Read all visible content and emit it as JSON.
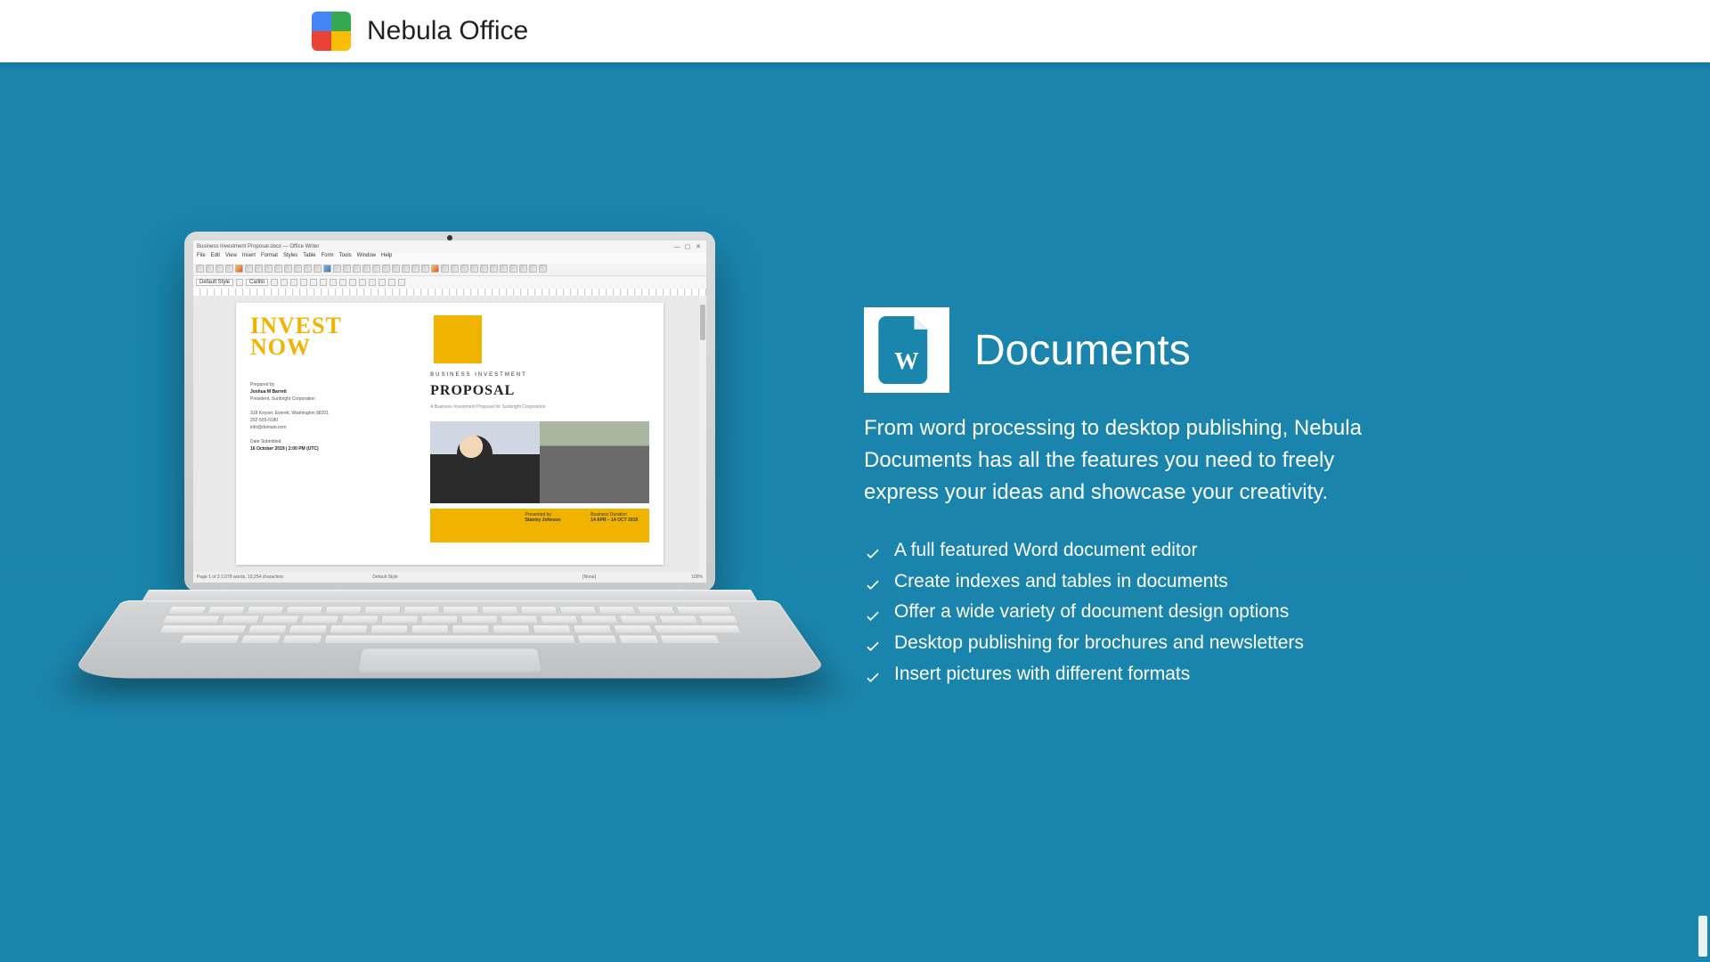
{
  "header": {
    "brand": "Nebula Office"
  },
  "colors": {
    "hero_bg": "#1a85ad",
    "accent_yellow": "#f0b400",
    "doc_icon": "#1a85ad"
  },
  "laptop": {
    "app_title": "Business Investment Proposal.docx — Office Writer",
    "menus": [
      "File",
      "Edit",
      "View",
      "Insert",
      "Format",
      "Styles",
      "Table",
      "Form",
      "Tools",
      "Window",
      "Help"
    ],
    "style_selector": "Default Style",
    "font_selector": "Carlito",
    "doc": {
      "headline_line1": "INVEST",
      "headline_line2": "NOW",
      "subject_label": "BUSINESS INVESTMENT",
      "subject_big": "PROPOSAL",
      "subject_sub": "A Business Investment Proposal\nfor Sunbright Corporation",
      "meta_prepared_label": "Prepared by",
      "meta_prepared_value": "Joshua M Barrett",
      "meta_title": "President, Sunbright Corporation",
      "meta_address": "318 Keyser, Everett, Washington 98201",
      "meta_phone": "202-555-0180",
      "meta_email": "info@domain.com",
      "meta_date_label": "Date Submitted",
      "meta_date_value": "16 October 2019  |  2:00 PM (UTC)",
      "footer_left_label": "Presented by",
      "footer_left_value": "Stanley Johnson",
      "footer_right_label": "Business Duration",
      "footer_right_value": "14 APR – 14 OCT 2019"
    },
    "status": {
      "left": "Page 1 of 3    2,078 words, 10,254 characters",
      "mid_left": "Default Style",
      "mid": "[None]",
      "right": "100%"
    }
  },
  "section": {
    "icon_letter": "W",
    "title": "Documents",
    "lead": "From word processing to desktop publishing, Nebula Documents has all the features you need to freely express your ideas and showcase your creativity.",
    "features": [
      "A full featured Word document editor",
      "Create indexes and tables in documents",
      "Offer a wide variety of document design options",
      "Desktop publishing for brochures and newsletters",
      "Insert pictures with different formats"
    ]
  }
}
